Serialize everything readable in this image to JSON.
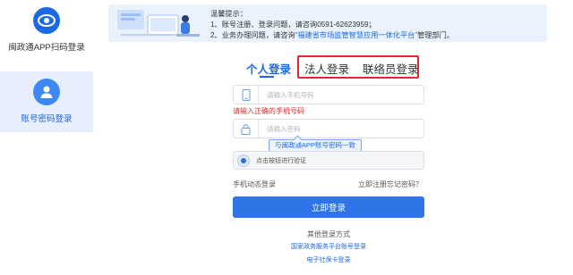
{
  "sidebar": {
    "items": [
      {
        "label": "闽政通APP扫码登录",
        "icon": "eye-logo-icon"
      },
      {
        "label": "账号密码登录",
        "icon": "user-icon"
      }
    ]
  },
  "notice": {
    "title": "温馨提示：",
    "line1_prefix": "1、账号注册、登录问题，请咨询",
    "line1_phone": "0591-62623959；",
    "line2_prefix": "2、业务办理问题，请咨询",
    "line2_highlight": "“福建省市场监管智慧应用一体化平台”",
    "line2_suffix": "管理部门。"
  },
  "tabs": {
    "personal": "个人登录",
    "legal": "法人登录",
    "contact": "联络员登录",
    "active": "personal"
  },
  "form": {
    "phone_placeholder": "请输入手机号码",
    "phone_error": "请输入正确的手机号码",
    "password_placeholder": "请输入密码",
    "tooltip": "与闽政通APP账号密码一致",
    "verify_text": "点击按钮进行验证"
  },
  "links": {
    "sms_login": "手机动态登录",
    "register": "立即注册",
    "forgot": "忘记密码？"
  },
  "login_button": "立即登录",
  "other": {
    "title": "其他登录方式",
    "links": [
      "国家政务服务平台账号登录",
      "电子社保卡登录"
    ]
  },
  "colors": {
    "accent": "#2f74e6",
    "error": "#e8262a",
    "highlight_box": "#e8262a"
  }
}
